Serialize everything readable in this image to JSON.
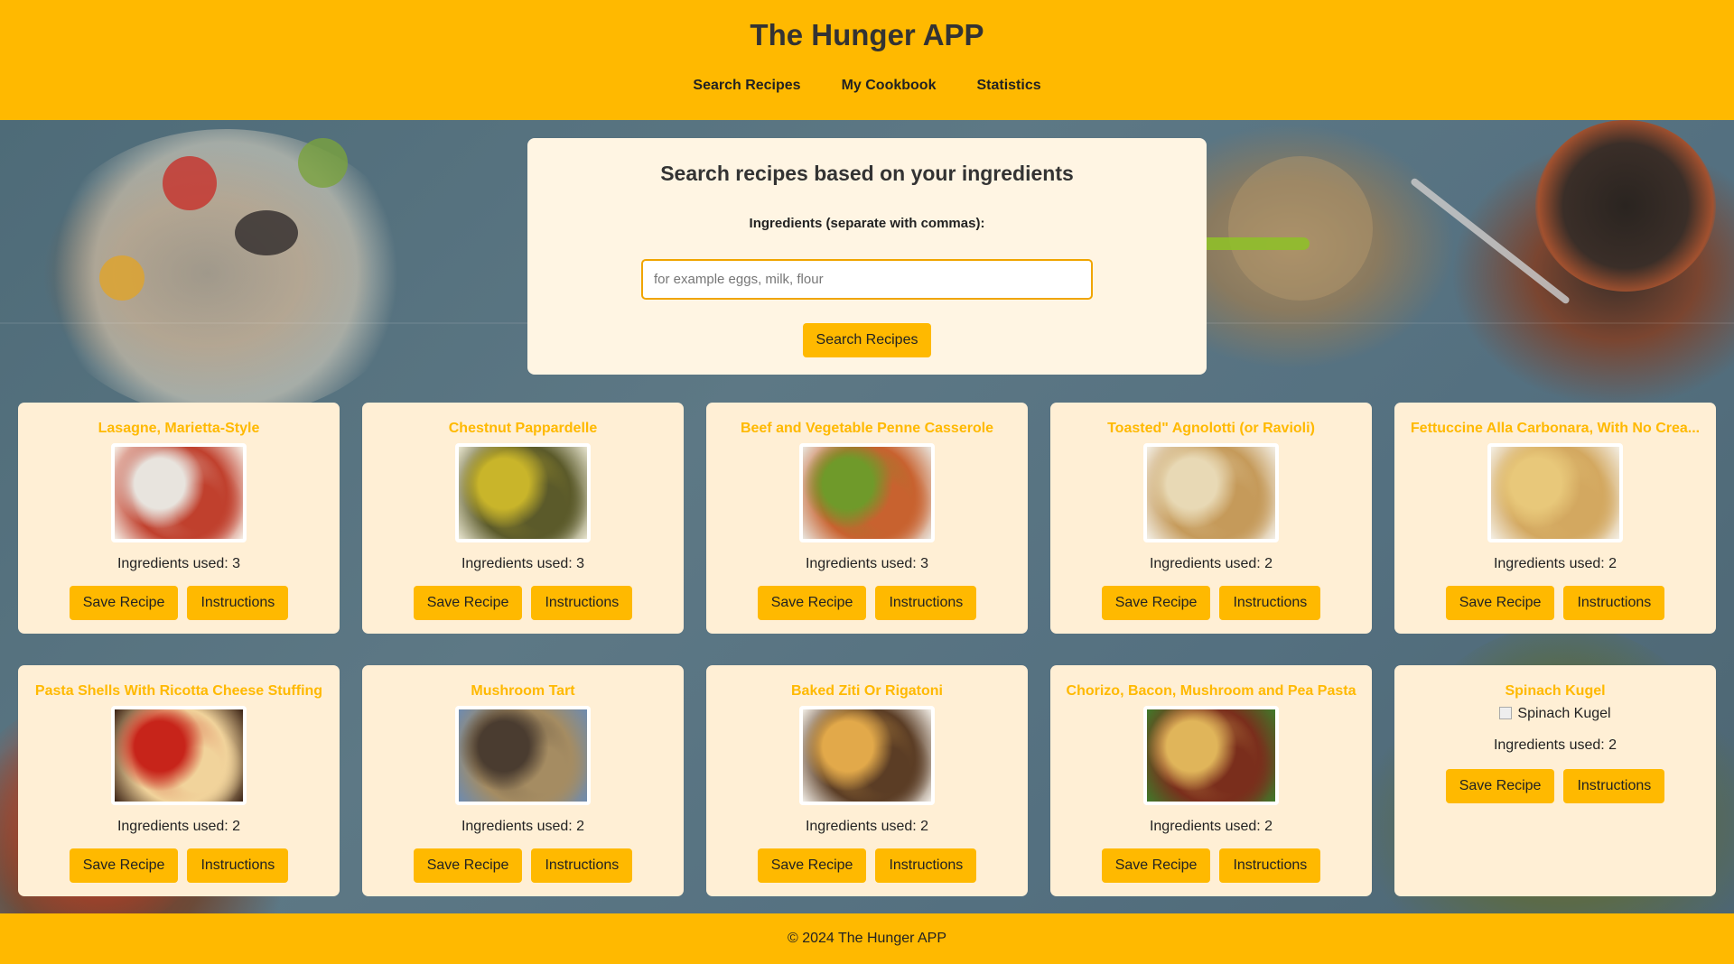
{
  "header": {
    "title": "The Hunger APP",
    "nav": [
      "Search Recipes",
      "My Cookbook",
      "Statistics"
    ]
  },
  "search": {
    "heading": "Search recipes based on your ingredients",
    "label": "Ingredients (separate with commas):",
    "placeholder": "for example eggs, milk, flour",
    "value": "",
    "button": "Search Recipes"
  },
  "cards": [
    {
      "title": "Lasagne, Marietta-Style",
      "used": "Ingredients used: 3",
      "save": "Save Recipe",
      "instructions": "Instructions",
      "image_colors": [
        "#e8e4de",
        "#c0402d",
        "#f5efe6"
      ]
    },
    {
      "title": "Chestnut Pappardelle",
      "used": "Ingredients used: 3",
      "save": "Save Recipe",
      "instructions": "Instructions",
      "image_colors": [
        "#c9b52a",
        "#5b5a2a",
        "#e8e5d0"
      ]
    },
    {
      "title": "Beef and Vegetable Penne Casserole",
      "used": "Ingredients used: 3",
      "save": "Save Recipe",
      "instructions": "Instructions",
      "image_colors": [
        "#6f9a2a",
        "#c8622f",
        "#e9e6df"
      ]
    },
    {
      "title": "Toasted\" Agnolotti (or Ravioli)",
      "used": "Ingredients used: 2",
      "save": "Save Recipe",
      "instructions": "Instructions",
      "image_colors": [
        "#e8d9b5",
        "#c59a5a",
        "#f3efe6"
      ]
    },
    {
      "title": "Fettuccine Alla Carbonara, With No Crea...",
      "used": "Ingredients used: 2",
      "save": "Save Recipe",
      "instructions": "Instructions",
      "image_colors": [
        "#e8c87a",
        "#d3a860",
        "#f4efe5"
      ]
    },
    {
      "title": "Pasta Shells With Ricotta Cheese Stuffing",
      "used": "Ingredients used: 2",
      "save": "Save Recipe",
      "instructions": "Instructions",
      "image_colors": [
        "#c7241a",
        "#f1d39b",
        "#3a2215"
      ]
    },
    {
      "title": "Mushroom Tart",
      "used": "Ingredients used: 2",
      "save": "Save Recipe",
      "instructions": "Instructions",
      "image_colors": [
        "#4a3c30",
        "#a58c62",
        "#6d8bb0"
      ]
    },
    {
      "title": "Baked Ziti Or Rigatoni",
      "used": "Ingredients used: 2",
      "save": "Save Recipe",
      "instructions": "Instructions",
      "image_colors": [
        "#e2a94a",
        "#5b3d25",
        "#f1ede6"
      ]
    },
    {
      "title": "Chorizo, Bacon, Mushroom and Pea Pasta",
      "used": "Ingredients used: 2",
      "save": "Save Recipe",
      "instructions": "Instructions",
      "image_colors": [
        "#e0b55a",
        "#7a2e1c",
        "#3f7a2a"
      ]
    },
    {
      "title": "Spinach Kugel",
      "used": "Ingredients used: 2",
      "save": "Save Recipe",
      "instructions": "Instructions",
      "image_alt": "Spinach Kugel"
    }
  ],
  "footer": {
    "text": "© 2024 The Hunger APP"
  },
  "colors": {
    "accent": "#ffb900",
    "card_bg": "#ffefd5",
    "panel_bg": "#fff5e3",
    "input_border": "#f0a500"
  }
}
